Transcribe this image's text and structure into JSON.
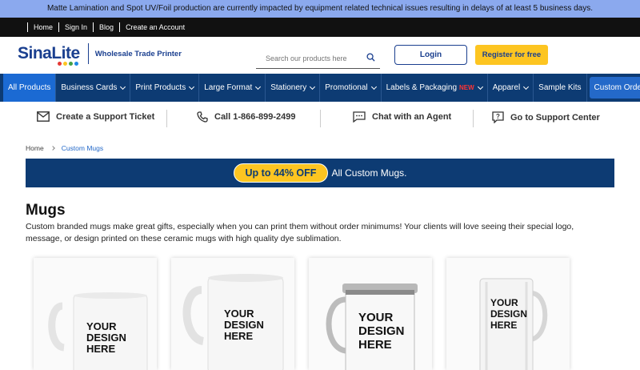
{
  "alert": {
    "text": "Matte Lamination and Spot UV/Foil production are currently impacted by equipment related technical issues resulting in delays of at least 5 business days."
  },
  "topbar": {
    "links": [
      "Home",
      "Sign In",
      "Blog",
      "Create an Account"
    ]
  },
  "header": {
    "logo": "SinaLite",
    "tagline": "Wholesale Trade Printer",
    "search_placeholder": "Search our products here",
    "login_label": "Login",
    "register_label": "Register for free"
  },
  "nav": {
    "items": [
      "All Products",
      "Business Cards",
      "Print Products",
      "Large Format",
      "Stationery",
      "Promotional",
      "Labels & Packaging",
      "Apparel",
      "Sample Kits",
      "Custom Order"
    ],
    "new_badge": "NEW"
  },
  "support": {
    "ticket": "Create a Support Ticket",
    "call": "Call 1-866-899-2499",
    "chat": "Chat with an Agent",
    "center": "Go to Support Center"
  },
  "breadcrumb": {
    "home": "Home",
    "current": "Custom Mugs"
  },
  "promo": {
    "pill": "Up to 44% OFF",
    "text": "All Custom Mugs."
  },
  "page": {
    "title": "Mugs",
    "description": "Custom branded mugs make great gifts, especially when you can print them without order minimums! Your clients will love seeing their special logo, message, or design printed on these ceramic mugs with high quality dye sublimation."
  },
  "products": [
    {
      "design_text": [
        "YOUR",
        "DESIGN",
        "HERE"
      ]
    },
    {
      "design_text": [
        "YOUR",
        "DESIGN",
        "HERE"
      ]
    },
    {
      "design_text": [
        "YOUR",
        "DESIGN",
        "HERE"
      ]
    },
    {
      "design_text": [
        "YOUR",
        "DESIGN",
        "HERE"
      ]
    }
  ],
  "colors": {
    "navy": "#0d3b73",
    "accent": "#fdc521",
    "alert_bg": "#8ba9ee",
    "nav_active": "#1b6ad3"
  }
}
